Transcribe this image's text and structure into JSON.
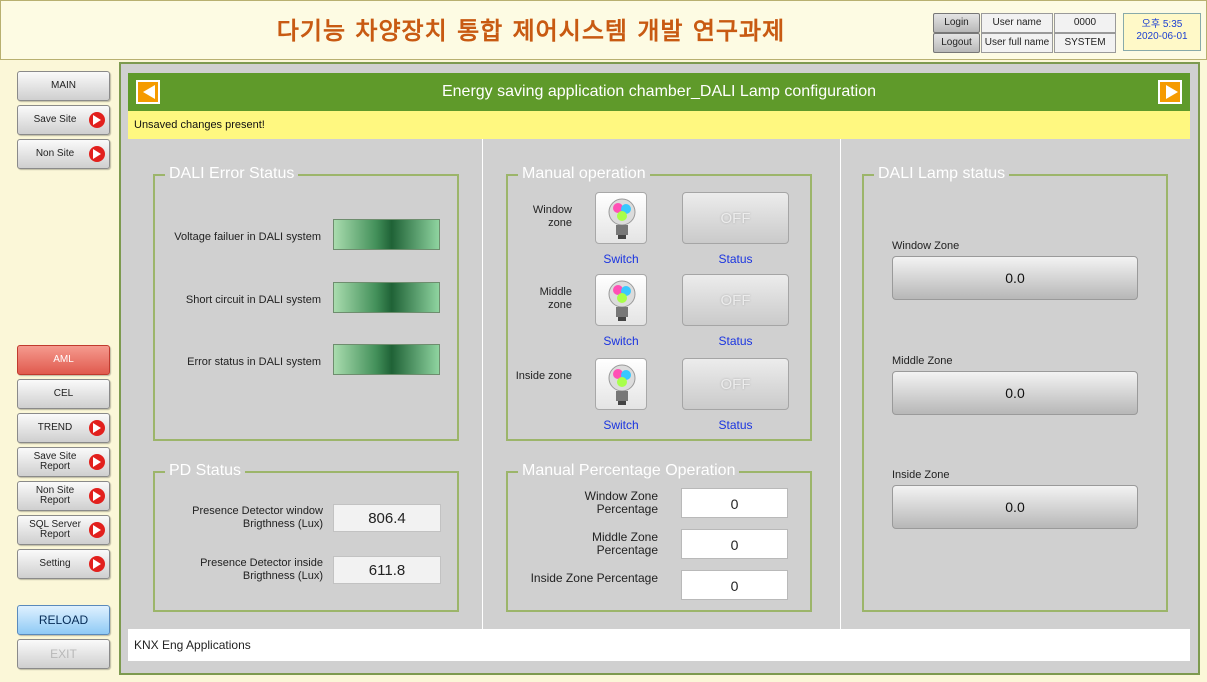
{
  "header": {
    "title": "다기능 차양장치 통합 제어시스템 개발 연구과제",
    "login_label": "Login",
    "logout_label": "Logout",
    "user_name_label": "User name",
    "user_full_name_label": "User full name",
    "user_name_value": "0000",
    "user_full_name_value": "SYSTEM",
    "time": "오후 5:35",
    "date": "2020-06-01"
  },
  "sidebar": {
    "main": "MAIN",
    "save_site": "Save Site",
    "non_site": "Non Site",
    "aml": "AML",
    "cel": "CEL",
    "trend": "TREND",
    "save_site_report": "Save Site Report",
    "non_site_report": "Non Site Report",
    "sql_server_report": "SQL Server Report",
    "setting": "Setting",
    "reload": "RELOAD",
    "exit": "EXIT"
  },
  "page": {
    "title": "Energy saving application chamber_DALI Lamp configuration",
    "warning": "Unsaved changes present!",
    "footer": "KNX Eng Applications"
  },
  "dali_error": {
    "title": "DALI Error Status",
    "items": [
      "Voltage failuer in DALI system",
      "Short circuit in DALI system",
      "Error status in DALI system"
    ]
  },
  "pd_status": {
    "title": "PD Status",
    "window_label": "Presence Detector window Brigthness (Lux)",
    "window_value": "806.4",
    "inside_label": "Presence Detector inside Brigthness (Lux)",
    "inside_value": "611.8"
  },
  "manual_operation": {
    "title": "Manual operation",
    "switch_label": "Switch",
    "status_label": "Status",
    "off_label": "OFF",
    "zones": [
      "Window zone",
      "Middle zone",
      "Inside zone"
    ]
  },
  "manual_percentage": {
    "title": "Manual Percentage Operation",
    "window_label": "Window Zone Percentage",
    "window_value": "0",
    "middle_label": "Middle Zone Percentage",
    "middle_value": "0",
    "inside_label": "Inside Zone Percentage",
    "inside_value": "0"
  },
  "lamp_status": {
    "title": "DALI Lamp status",
    "window_label": "Window Zone",
    "window_value": "0.0",
    "middle_label": "Middle Zone",
    "middle_value": "0.0",
    "inside_label": "Inside Zone",
    "inside_value": "0.0"
  },
  "colors": {
    "title_bar": "#5f9a2a",
    "warning_bar": "#fff880",
    "header_title": "#c85a12",
    "active_nav": "#e05a4e",
    "link_blue": "#1a34e0"
  }
}
